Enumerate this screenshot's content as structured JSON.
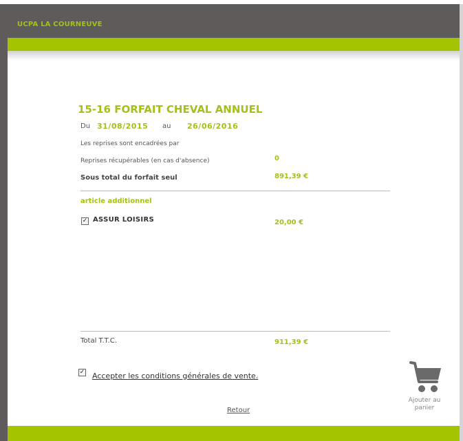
{
  "header": {
    "title": "UCPA LA COURNEUVE"
  },
  "product": {
    "title": "15-16 FORFAIT CHEVAL ANNUEL",
    "du_label": "Du",
    "date_start": "31/08/2015",
    "au_label": "au",
    "date_end": "26/06/2016",
    "encadrees_label": "Les reprises sont encadrées par",
    "recuperables_label": "Reprises récupérables (en cas d'absence)",
    "recuperables_value": "0",
    "sous_total_label": "Sous total du forfait seul",
    "sous_total_value": "891,39 €"
  },
  "additional": {
    "heading": "article additionnel",
    "items": [
      {
        "label": "ASSUR LOISIRS",
        "price": "20,00 €",
        "checked": true
      }
    ]
  },
  "total": {
    "label": "Total T.T.C.",
    "value": "911,39 €"
  },
  "terms": {
    "label": "Accepter les conditions générales de vente.",
    "checked": true
  },
  "actions": {
    "retour": "Retour",
    "cart_line1": "Ajouter au",
    "cart_line2": "panier"
  },
  "colors": {
    "accent": "#a4c400",
    "dark": "#5e5c5b"
  },
  "icons": {
    "cart": "shopping-cart-icon",
    "checkbox": "checkmark-icon"
  }
}
